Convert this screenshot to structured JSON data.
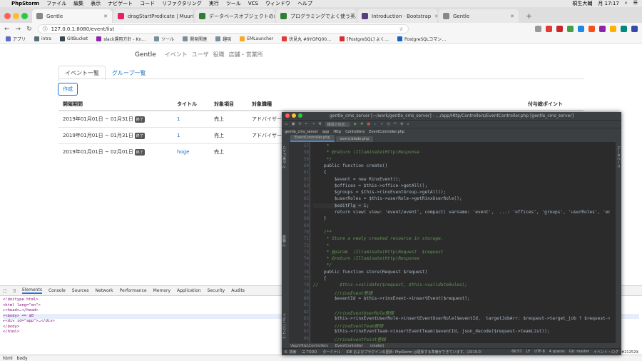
{
  "os_menu": {
    "app_name": "PhpStorm",
    "items": [
      "ファイル",
      "編集",
      "表示",
      "ナビゲート",
      "コード",
      "リファクタリング",
      "実行",
      "ツール",
      "VCS",
      "ウィンドウ",
      "ヘルプ"
    ],
    "user": "桐生大輔",
    "time": "月 17:17"
  },
  "browser": {
    "tabs": [
      {
        "title": "Gentle",
        "color": "#888888",
        "active": true
      },
      {
        "title": "dragStartPredicate | Muuri - …",
        "color": "#e91e63",
        "active": false
      },
      {
        "title": "データベースオブジェクトの命名…",
        "color": "#2e7d32",
        "active": false
      },
      {
        "title": "プログラミングでよく使う英単語…",
        "color": "#2e7d32",
        "active": false
      },
      {
        "title": "Introduction · Bootstrap",
        "color": "#563d7c",
        "active": false
      },
      {
        "title": "Gentle",
        "color": "#888888",
        "active": false
      }
    ],
    "url": "127.0.0.1:8080/event/list",
    "ext_colors": [
      "#999999",
      "#e53935",
      "#c62828",
      "#43a047",
      "#1e88e5",
      "#f4511e",
      "#8e24aa",
      "#ffb300",
      "#00897b",
      "#3949ab"
    ],
    "bookmarks": [
      {
        "label": "アプリ",
        "color": "#5c6bc0"
      },
      {
        "label": "intra",
        "color": "#546e7a"
      },
      {
        "label": "GitBucket",
        "color": "#37474f"
      },
      {
        "label": "slack運用方針 - Kn…",
        "color": "#8e24aa"
      },
      {
        "label": "ツール",
        "color": "#78909c"
      },
      {
        "label": "開発関連",
        "color": "#78909c"
      },
      {
        "label": "趣味",
        "color": "#78909c"
      },
      {
        "label": "EMLauncher",
        "color": "#f9a825"
      },
      {
        "label": "伏見丸 #9YGPQ00…",
        "color": "#e53935"
      },
      {
        "label": "[PostgreSQL] よく…",
        "color": "#d32f2f"
      },
      {
        "label": "PostgreSQLコマン…",
        "color": "#1565c0"
      }
    ]
  },
  "site": {
    "brand": "Gentle",
    "nav": [
      "イベント",
      "ユーザ",
      "役職",
      "店舗・営業所"
    ],
    "tabs": [
      "イベント一覧",
      "グループ一覧"
    ],
    "create_label": "作成",
    "columns": [
      "開催期間",
      "タイトル",
      "対象項目",
      "対象職種",
      "付与総ポイント"
    ],
    "rows": [
      {
        "period": "2019年01月01日 ~ 01月31日",
        "badge": "終了",
        "title": "1",
        "target": "売上",
        "job": "アドバイザー"
      },
      {
        "period": "2019年01月01日 ~ 01月31日",
        "badge": "終了",
        "title": "1",
        "target": "売上",
        "job": "アドバイザー"
      },
      {
        "period": "2019年01月01日 ~ 02月01日",
        "badge": "終了",
        "title": "hoge",
        "target": "売上",
        "job": ""
      }
    ]
  },
  "devtools": {
    "tabs": [
      "Elements",
      "Console",
      "Sources",
      "Network",
      "Performance",
      "Memory",
      "Application",
      "Security",
      "Audits"
    ],
    "dom_lines": [
      "<!doctype html>",
      "<html lang=\"en\">",
      "▸<head>…</head>",
      "▾<body> == $0",
      "  ▸<div id=\"app\">…</div>",
      "  </body>",
      "</html>"
    ],
    "crumbs": [
      "html",
      "body"
    ],
    "right_text": "color: #212529;"
  },
  "ide": {
    "title": "gentle_cms_server [~/work/gentle_cms_server] - …/app/Http/Controllers/EventController.php [gentle_cms_server]",
    "toolbar_item": "構成の追加...",
    "breadcrumb": [
      "gentle_cms_server",
      "app",
      "Http",
      "Controllers",
      "EventController.php"
    ],
    "tabs": [
      "EventController.php",
      "event.blade.php"
    ],
    "left_panels": [
      "1: プロジェクト",
      "2: 構造",
      "2: お気に入り"
    ],
    "right_panel": "データベース",
    "line_numbers": [
      "57",
      "58",
      "59",
      "60",
      "61",
      "62",
      "63",
      "64",
      "65",
      "66",
      "67",
      "68",
      "69",
      "70",
      "71",
      "72",
      "73",
      "74",
      "75",
      "76",
      "77",
      "78",
      "79",
      "80",
      "81",
      "82",
      "83",
      "84",
      "85",
      "86"
    ],
    "code_lines": [
      "     *",
      "     * @return \\Illuminate\\Http\\Response",
      "     */",
      "    public function create()",
      "    {",
      "        $event = new RinxEvent();",
      "        $offices = $this->office->getAll();",
      "        $groups = $this->rinxEventGroup->getAll();",
      "        $userRoles = $this->userRole->getRinxUserRole();",
      "        $editFlg = 1;",
      "        return view( view: 'event/event', compact( varname: 'event',  ...: 'offices', 'groups', 'userRoles', 'editFlg'));",
      "    }",
      "",
      "    /**",
      "     * Store a newly created resource in storage.",
      "     *",
      "     * @param  \\Illuminate\\Http\\Request  $request",
      "     * @return \\Illuminate\\Http\\Response",
      "     */",
      "    public function store(Request $request)",
      "    {",
      "//        $this->validate($request, $this->validateRules);",
      "        //rinxEvent登録",
      "        $eventId = $this->rinxEvent->insertEvent($request);",
      "",
      "        //rinxEventUserRole登録",
      "        $this->rinxEventUserRole->insertEventUserRole($eventId,  targetJobArr: $request->target_job ? $request->target_",
      "        //rinxEventTeam登録",
      "        $this->rinxEventTeam->insertEventTeam($eventId, json_decode($request->teamList));",
      "        //rinxEventPoint登録"
    ],
    "path_crumbs": [
      "\\App\\Http\\Controllers",
      "EventController",
      "create()"
    ],
    "bottom_tabs": [
      "6: 検索",
      "☰ TODO",
      "ターミナル"
    ],
    "right_bottom": "イベント・ログ",
    "status": "IDE およびプラグインの更新: PhpStorm は更新する準備ができています。(2019-03-15 15:13)",
    "position": "66:57",
    "eol": "LF",
    "encoding": "UTF-8",
    "indent": "4 spaces",
    "git": "Git: master"
  }
}
